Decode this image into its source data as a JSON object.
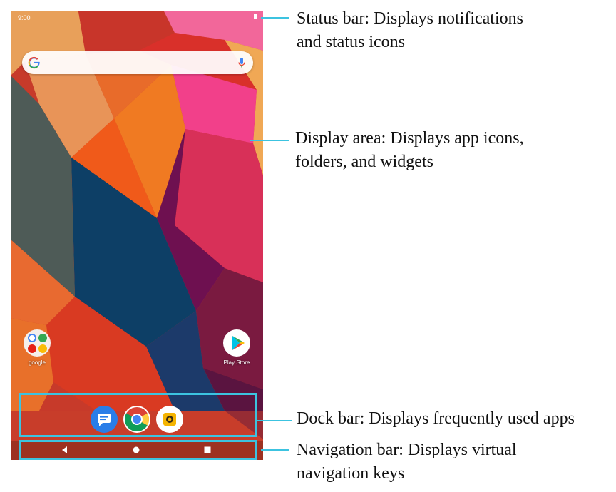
{
  "status_bar": {
    "time": "9:00"
  },
  "search": {
    "google_icon": "google-g-icon",
    "mic_icon": "microphone-icon"
  },
  "apps": {
    "google_folder": {
      "label": "google"
    },
    "play_store": {
      "label": "Play Store"
    }
  },
  "dock": {
    "apps": [
      "messages-icon",
      "chrome-icon",
      "camera-icon"
    ]
  },
  "navigation": {
    "keys": [
      "back-icon",
      "home-icon",
      "recents-icon"
    ]
  },
  "annotations": {
    "status_bar": [
      "Status bar: Displays notifications",
      "and status icons"
    ],
    "display_area": [
      "Display area: Displays app icons,",
      "folders, and widgets"
    ],
    "dock_bar": [
      "Dock bar: Displays frequently used apps"
    ],
    "navigation_bar": [
      "Navigation bar: Displays virtual",
      "navigation keys"
    ]
  },
  "colors": {
    "highlight": "#3cc3e0",
    "leader_line": "#3cc3e0",
    "annotation_text": "#111111"
  }
}
